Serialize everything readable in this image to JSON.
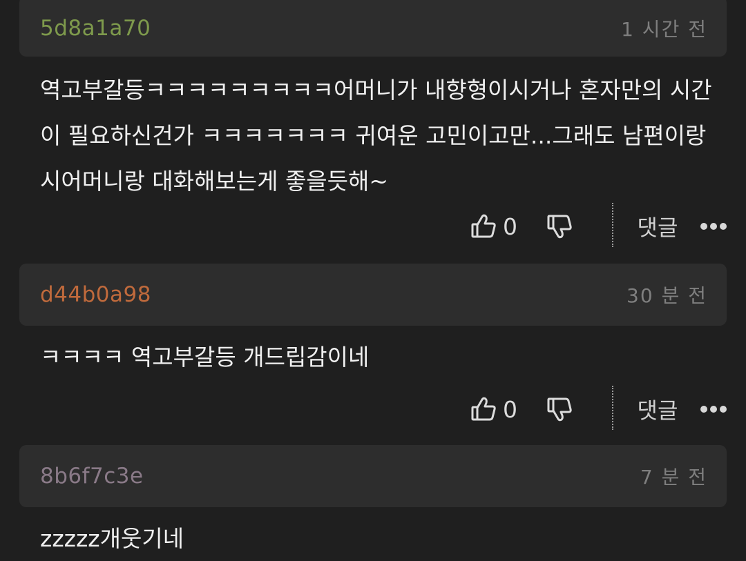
{
  "comments": [
    {
      "author": "5d8a1a70",
      "author_color": "#7e9a4c",
      "time": "1 시간 전",
      "body": "역고부갈등ㅋㅋㅋㅋㅋㅋㅋㅋㅋ어머니가 내향형이시거나 혼자만의 시간이 필요하신건가 ㅋㅋㅋㅋㅋㅋㅋ 귀여운 고민이고만...그래도 남편이랑 시어머니랑 대화해보는게 좋을듯해~",
      "likes": "0",
      "reply_label": "댓글"
    },
    {
      "author": "d44b0a98",
      "author_color": "#c06a3c",
      "time": "30 분 전",
      "body": "ㅋㅋㅋㅋ 역고부갈등 개드립감이네",
      "likes": "0",
      "reply_label": "댓글"
    },
    {
      "author": "8b6f7c3e",
      "author_color": "#8a7a88",
      "time": "7 분 전",
      "body": "zzzzz개웃기네"
    }
  ]
}
